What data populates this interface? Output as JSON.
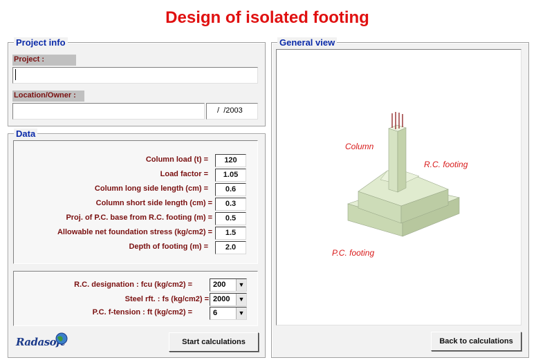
{
  "page_title": "Design of isolated footing",
  "project_info": {
    "legend": "Project info",
    "project_label": "Project :",
    "project_value": "",
    "location_label": "Location/Owner :",
    "location_value": "",
    "date_value": " /  /2003"
  },
  "data_section": {
    "legend": "Data",
    "rows": [
      {
        "label": "Column load (t) =",
        "value": "120"
      },
      {
        "label": "Load factor =",
        "value": "1.05"
      },
      {
        "label": "Column long side length (cm) =",
        "value": "0.6"
      },
      {
        "label": "Column short side length (cm) =",
        "value": "0.3"
      },
      {
        "label": "Proj. of P.C. base from R.C. footing (m) =",
        "value": "0.5"
      },
      {
        "label": "Allowable net foundation stress (kg/cm2) =",
        "value": "1.5"
      },
      {
        "label": "Depth of footing (m) =",
        "value": "2.0"
      }
    ],
    "selects": [
      {
        "label": "R.C. designation : fcu (kg/cm2) =",
        "value": "200"
      },
      {
        "label": "Steel rft. : fs (kg/cm2) =",
        "value": "2000"
      },
      {
        "label": "P.C.  f-tension : ft (kg/cm2) =",
        "value": "6"
      }
    ]
  },
  "logo_text": "Radasoft",
  "start_button": "Start calculations",
  "general_view": {
    "legend": "General view",
    "column_label": "Column",
    "rc_label": "R.C. footing",
    "pc_label": "P.C. footing",
    "back_button": "Back to calculations"
  },
  "colors": {
    "title": "#e01010",
    "legend": "#0a2aa8",
    "label": "#7a1010",
    "drawing_label": "#d81a1a",
    "footing_fill": "#d8e6c4"
  },
  "icons": {
    "dropdown": "▼"
  }
}
